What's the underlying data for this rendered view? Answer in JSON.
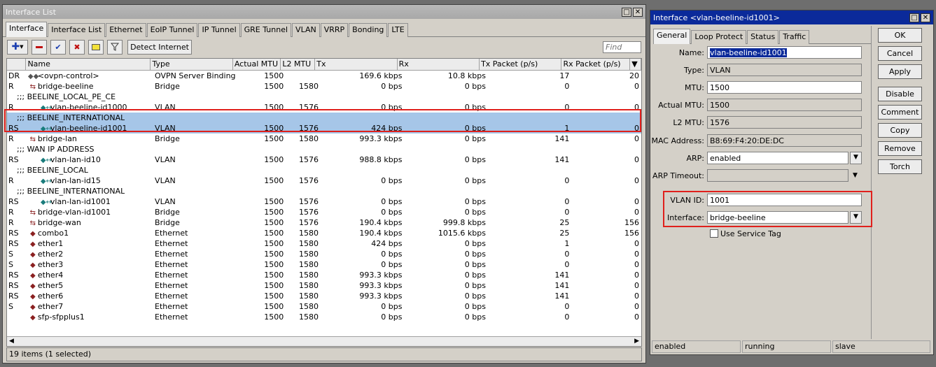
{
  "left_window": {
    "title": "Interface List",
    "tabs": [
      "Interface",
      "Interface List",
      "Ethernet",
      "EoIP Tunnel",
      "IP Tunnel",
      "GRE Tunnel",
      "VLAN",
      "VRRP",
      "Bonding",
      "LTE"
    ],
    "detect_label": "Detect Internet",
    "find_placeholder": "Find",
    "columns": [
      "Name",
      "Type",
      "Actual MTU",
      "L2 MTU",
      "Tx",
      "Rx",
      "Tx Packet (p/s)",
      "Rx Packet (p/s)"
    ],
    "status": "19 items (1 selected)"
  },
  "rows": [
    {
      "flag": "DR",
      "name": "<ovpn-control>",
      "type": "OVPN Server Binding",
      "mtu": "1500",
      "l2": "",
      "tx": "169.6 kbps",
      "rx": "10.8 kbps",
      "txp": "17",
      "rxp": "20",
      "icon": "ovpn"
    },
    {
      "flag": "R",
      "name": "bridge-beeline",
      "type": "Bridge",
      "mtu": "1500",
      "l2": "1580",
      "tx": "0 bps",
      "rx": "0 bps",
      "txp": "0",
      "rxp": "0",
      "icon": "br"
    },
    {
      "comment": ";;; BEELINE_LOCAL_PE_CE"
    },
    {
      "flag": "R",
      "name": "vlan-beeline-id1000",
      "type": "VLAN",
      "mtu": "1500",
      "l2": "1576",
      "tx": "0 bps",
      "rx": "0 bps",
      "txp": "0",
      "rxp": "0",
      "icon": "vlan"
    },
    {
      "comment": ";;; BEELINE_INTERNATIONAL",
      "sel": true
    },
    {
      "flag": "RS",
      "name": "vlan-beeline-id1001",
      "type": "VLAN",
      "mtu": "1500",
      "l2": "1576",
      "tx": "424 bps",
      "rx": "0 bps",
      "txp": "1",
      "rxp": "0",
      "icon": "vlan",
      "sel": true
    },
    {
      "flag": "R",
      "name": "bridge-lan",
      "type": "Bridge",
      "mtu": "1500",
      "l2": "1580",
      "tx": "993.3 kbps",
      "rx": "0 bps",
      "txp": "141",
      "rxp": "0",
      "icon": "br"
    },
    {
      "comment": ";;; WAN IP ADDRESS"
    },
    {
      "flag": "RS",
      "name": "vlan-lan-id10",
      "type": "VLAN",
      "mtu": "1500",
      "l2": "1576",
      "tx": "988.8 kbps",
      "rx": "0 bps",
      "txp": "141",
      "rxp": "0",
      "icon": "vlan"
    },
    {
      "comment": ";;; BEELINE_LOCAL"
    },
    {
      "flag": "R",
      "name": "vlan-lan-id15",
      "type": "VLAN",
      "mtu": "1500",
      "l2": "1576",
      "tx": "0 bps",
      "rx": "0 bps",
      "txp": "0",
      "rxp": "0",
      "icon": "vlan"
    },
    {
      "comment": ";;; BEELINE_INTERNATIONAL"
    },
    {
      "flag": "RS",
      "name": "vlan-lan-id1001",
      "type": "VLAN",
      "mtu": "1500",
      "l2": "1576",
      "tx": "0 bps",
      "rx": "0 bps",
      "txp": "0",
      "rxp": "0",
      "icon": "vlan"
    },
    {
      "flag": "R",
      "name": "bridge-vlan-id1001",
      "type": "Bridge",
      "mtu": "1500",
      "l2": "1576",
      "tx": "0 bps",
      "rx": "0 bps",
      "txp": "0",
      "rxp": "0",
      "icon": "br"
    },
    {
      "flag": "R",
      "name": "bridge-wan",
      "type": "Bridge",
      "mtu": "1500",
      "l2": "1576",
      "tx": "190.4 kbps",
      "rx": "999.8 kbps",
      "txp": "25",
      "rxp": "156",
      "icon": "br"
    },
    {
      "flag": "RS",
      "name": "combo1",
      "type": "Ethernet",
      "mtu": "1500",
      "l2": "1580",
      "tx": "190.4 kbps",
      "rx": "1015.6 kbps",
      "txp": "25",
      "rxp": "156",
      "icon": "eth"
    },
    {
      "flag": "RS",
      "name": "ether1",
      "type": "Ethernet",
      "mtu": "1500",
      "l2": "1580",
      "tx": "424 bps",
      "rx": "0 bps",
      "txp": "1",
      "rxp": "0",
      "icon": "eth"
    },
    {
      "flag": "S",
      "name": "ether2",
      "type": "Ethernet",
      "mtu": "1500",
      "l2": "1580",
      "tx": "0 bps",
      "rx": "0 bps",
      "txp": "0",
      "rxp": "0",
      "icon": "eth"
    },
    {
      "flag": "S",
      "name": "ether3",
      "type": "Ethernet",
      "mtu": "1500",
      "l2": "1580",
      "tx": "0 bps",
      "rx": "0 bps",
      "txp": "0",
      "rxp": "0",
      "icon": "eth"
    },
    {
      "flag": "RS",
      "name": "ether4",
      "type": "Ethernet",
      "mtu": "1500",
      "l2": "1580",
      "tx": "993.3 kbps",
      "rx": "0 bps",
      "txp": "141",
      "rxp": "0",
      "icon": "eth"
    },
    {
      "flag": "RS",
      "name": "ether5",
      "type": "Ethernet",
      "mtu": "1500",
      "l2": "1580",
      "tx": "993.3 kbps",
      "rx": "0 bps",
      "txp": "141",
      "rxp": "0",
      "icon": "eth"
    },
    {
      "flag": "RS",
      "name": "ether6",
      "type": "Ethernet",
      "mtu": "1500",
      "l2": "1580",
      "tx": "993.3 kbps",
      "rx": "0 bps",
      "txp": "141",
      "rxp": "0",
      "icon": "eth"
    },
    {
      "flag": "S",
      "name": "ether7",
      "type": "Ethernet",
      "mtu": "1500",
      "l2": "1580",
      "tx": "0 bps",
      "rx": "0 bps",
      "txp": "0",
      "rxp": "0",
      "icon": "eth"
    },
    {
      "flag": "",
      "name": "sfp-sfpplus1",
      "type": "Ethernet",
      "mtu": "1500",
      "l2": "1580",
      "tx": "0 bps",
      "rx": "0 bps",
      "txp": "0",
      "rxp": "0",
      "icon": "eth"
    }
  ],
  "right_window": {
    "title": "Interface <vlan-beeline-id1001>",
    "tabs": [
      "General",
      "Loop Protect",
      "Status",
      "Traffic"
    ],
    "fields": {
      "name_label": "Name:",
      "name": "vlan-beeline-id1001",
      "type_label": "Type:",
      "type": "VLAN",
      "mtu_label": "MTU:",
      "mtu": "1500",
      "amtu_label": "Actual MTU:",
      "amtu": "1500",
      "l2_label": "L2 MTU:",
      "l2": "1576",
      "mac_label": "MAC Address:",
      "mac": "B8:69:F4:20:DE:DC",
      "arp_label": "ARP:",
      "arp": "enabled",
      "arpt_label": "ARP Timeout:",
      "arpt": "",
      "vlanid_label": "VLAN ID:",
      "vlanid": "1001",
      "iface_label": "Interface:",
      "iface": "bridge-beeline",
      "svc_label": "Use Service Tag"
    },
    "buttons": [
      "OK",
      "Cancel",
      "Apply",
      "Disable",
      "Comment",
      "Copy",
      "Remove",
      "Torch"
    ],
    "status": [
      "enabled",
      "running",
      "slave"
    ]
  }
}
